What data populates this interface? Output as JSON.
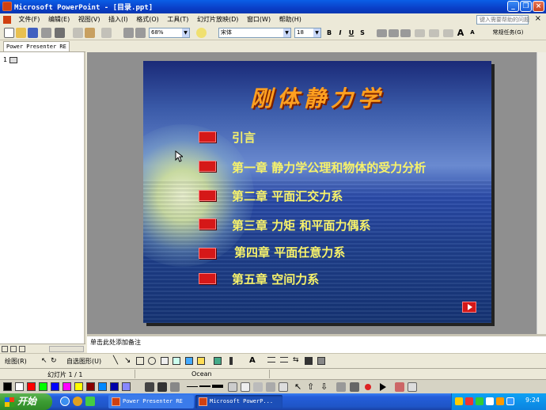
{
  "window": {
    "title": "Microsoft PowerPoint - [目录.ppt]",
    "controls": {
      "minimize": "_",
      "restore": "❐",
      "close": "×"
    }
  },
  "menu": {
    "items": [
      "文件(F)",
      "编辑(E)",
      "视图(V)",
      "插入(I)",
      "格式(O)",
      "工具(T)",
      "幻灯片放映(D)",
      "窗口(W)",
      "帮助(H)"
    ],
    "help_placeholder": "键入需要帮助的问题",
    "close_doc": "×"
  },
  "toolbar": {
    "zoom": "68%",
    "font": "宋体",
    "font_size": "18",
    "bold": "B",
    "italic": "I",
    "underline": "U",
    "shadow": "S",
    "grow_font": "A",
    "shrink_font": "A",
    "task_pane": "常规任务(G)"
  },
  "outline_pane": {
    "tab_label": "Power Presenter RE",
    "slide_number": "1"
  },
  "slide": {
    "title": "刚体静力学",
    "items": [
      "引言",
      "第一章  静力学公理和物体的受力分析",
      "第二章  平面汇交力系",
      "第三章  力矩  和平面力偶系",
      "第四章  平面任意力系",
      "第五章  空间力系"
    ]
  },
  "notes": {
    "placeholder": "单击此处添加备注"
  },
  "drawing_toolbar": {
    "draw_label": "绘图(R)",
    "autoshapes_label": "自选图形(U)"
  },
  "status_bar": {
    "slide_indicator": "幻灯片 1 / 1",
    "design_template": "Ocean"
  },
  "presenter_toolbar": {
    "swatch_colors": [
      "#000000",
      "#ffffff",
      "#ff0000",
      "#00ff00",
      "#0000ff",
      "#ff00ff",
      "#ffff00",
      "#880000",
      "#0088ff",
      "#0000aa",
      "#8888ff"
    ]
  },
  "taskbar": {
    "start_label": "开始",
    "tasks": [
      "Power Presenter RE",
      "Microsoft PowerP..."
    ],
    "clock": "9:24"
  },
  "colors": {
    "title_bar": "#0a4fd8",
    "slide_title": "#ffa020",
    "slide_text": "#f7f26a",
    "bullet": "#d51818"
  }
}
